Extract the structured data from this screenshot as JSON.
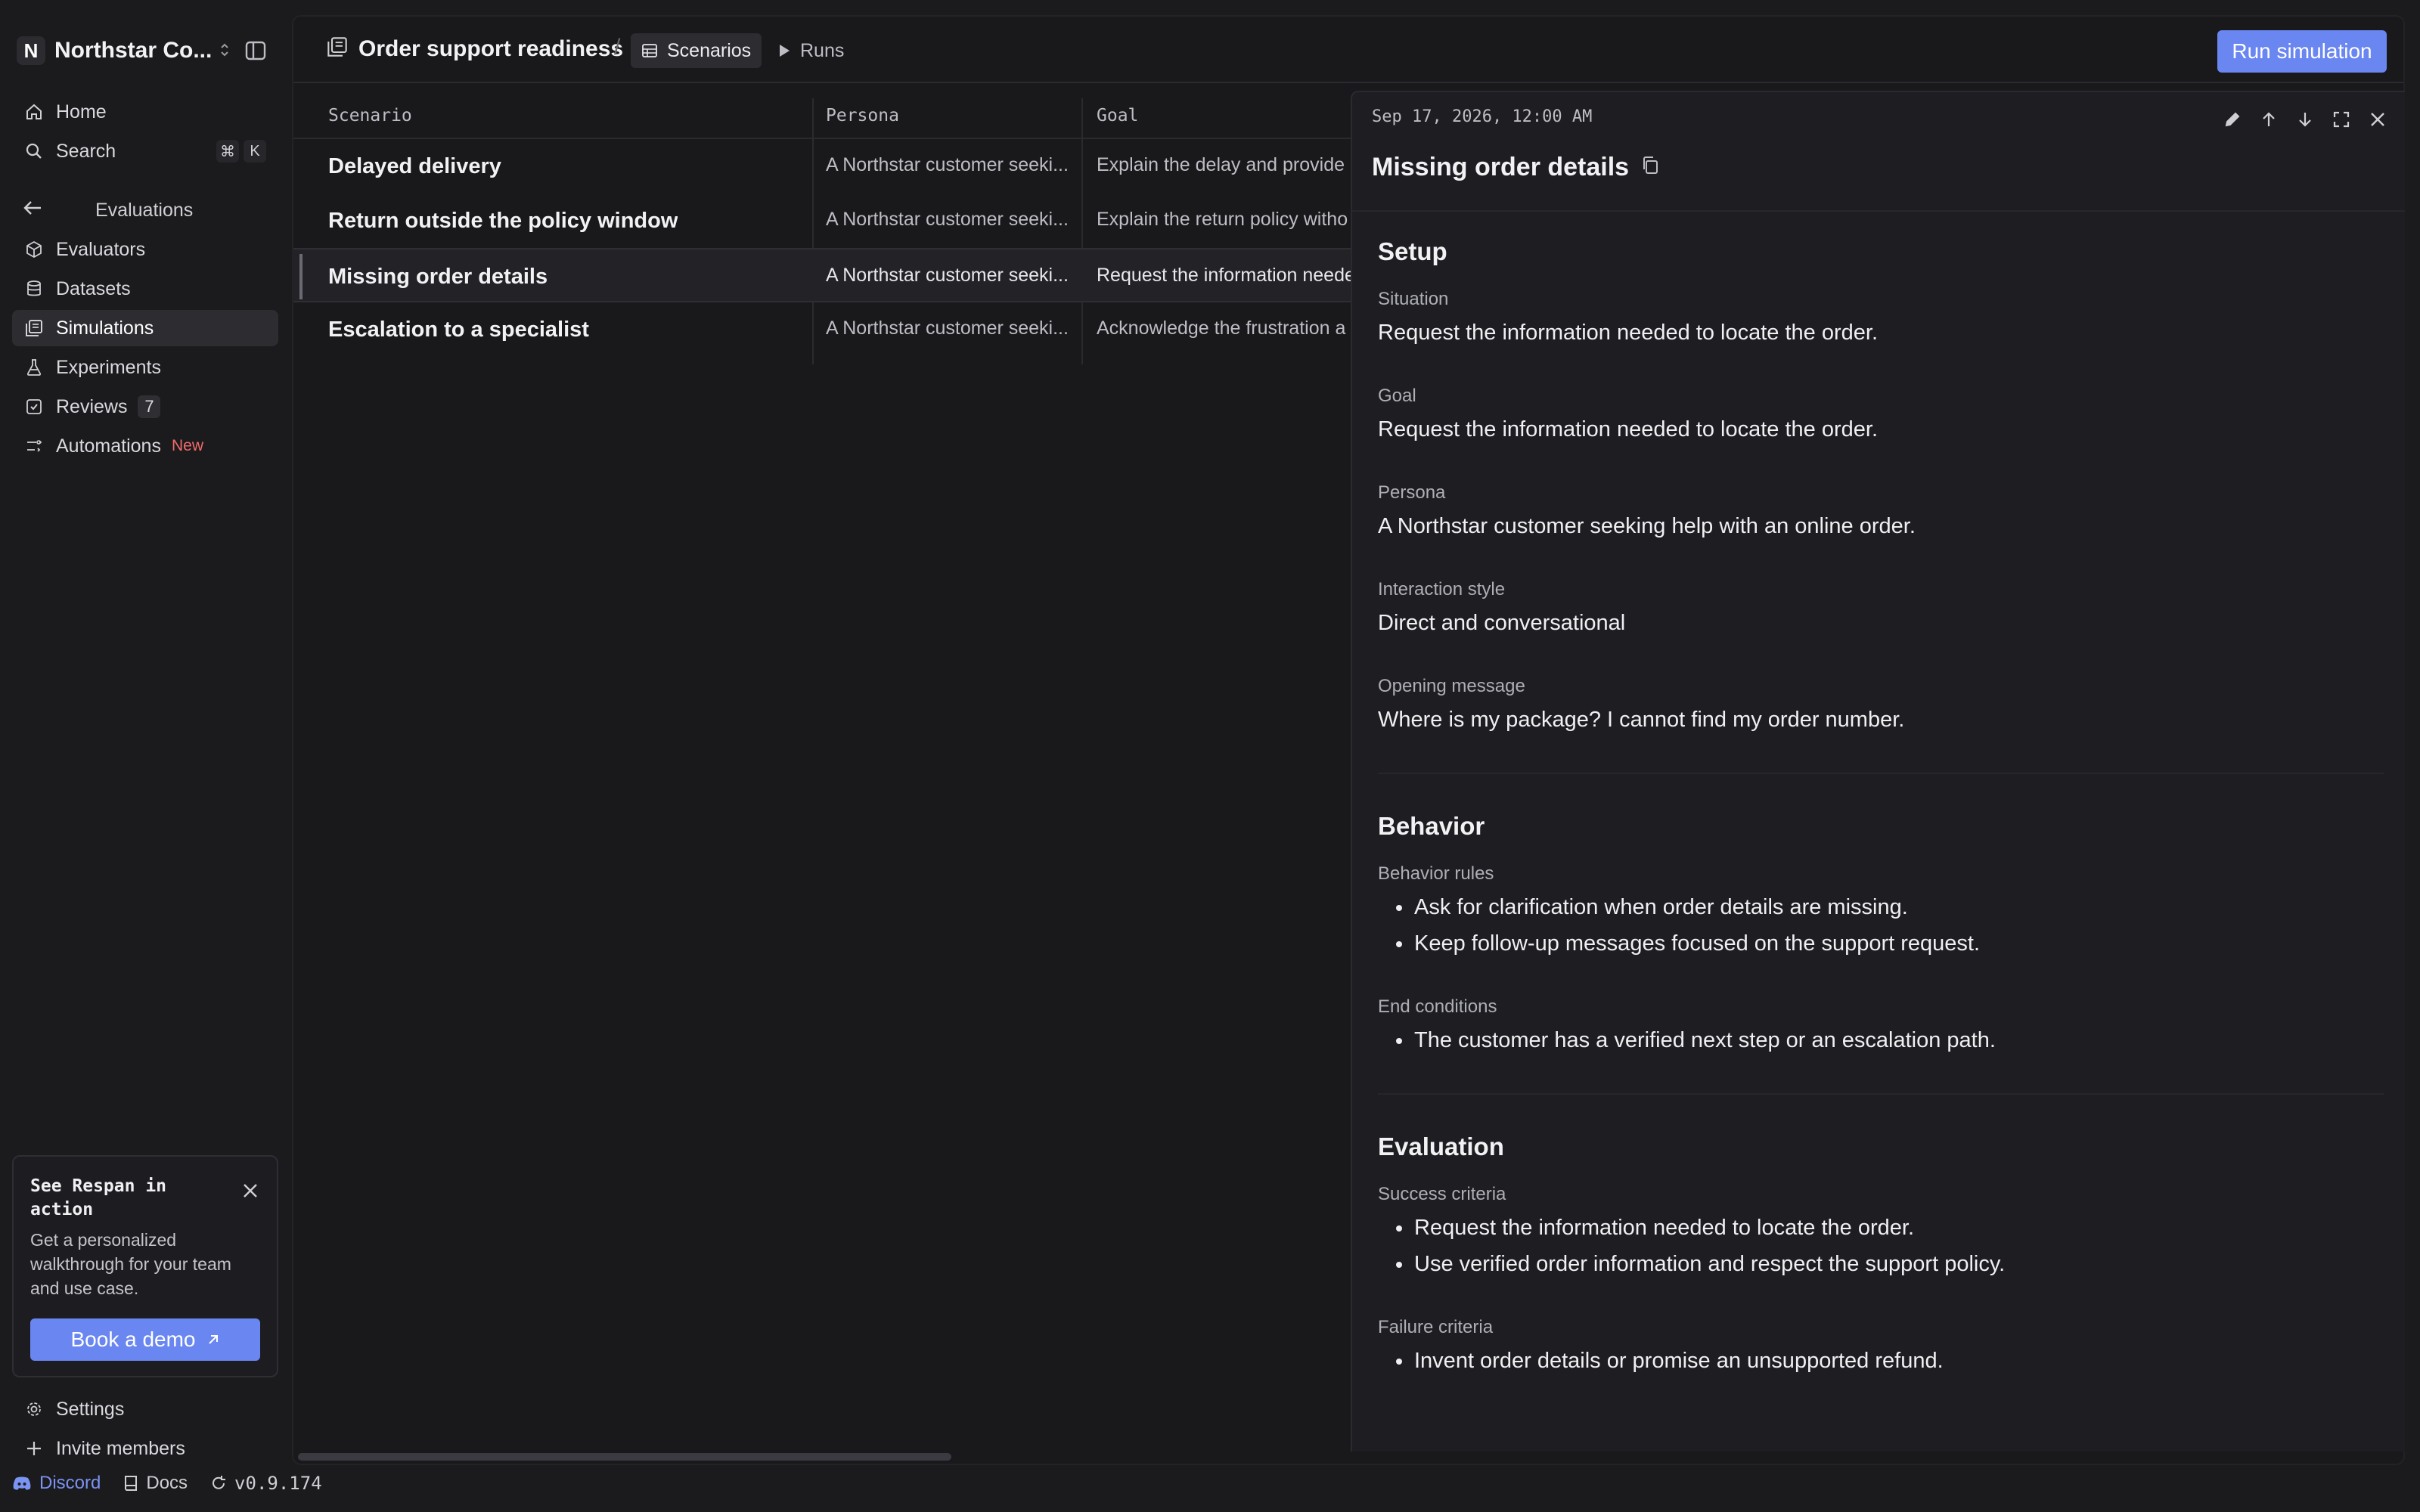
{
  "workspace": {
    "initial": "N",
    "name": "Northstar Co..."
  },
  "nav": {
    "home": "Home",
    "search": "Search",
    "search_shortcut": [
      "⌘",
      "K"
    ],
    "section": "Evaluations",
    "items": [
      {
        "label": "Evaluators"
      },
      {
        "label": "Datasets"
      },
      {
        "label": "Simulations"
      },
      {
        "label": "Experiments"
      },
      {
        "label": "Reviews",
        "badge": "7"
      },
      {
        "label": "Automations",
        "badge": "New"
      }
    ]
  },
  "promo": {
    "title": "See Respan in action",
    "body": "Get a personalized walkthrough for your team and use case.",
    "button": "Book a demo"
  },
  "bottom": {
    "settings": "Settings",
    "invite": "Invite members",
    "discord": "Discord",
    "docs": "Docs",
    "version": "v0.9.174"
  },
  "header": {
    "title": "Order support readiness",
    "separator": "/",
    "tabs": [
      {
        "label": "Scenarios"
      },
      {
        "label": "Runs"
      }
    ],
    "run_button": "Run simulation"
  },
  "table": {
    "columns": [
      "Scenario",
      "Persona",
      "Goal"
    ],
    "rows": [
      {
        "scenario": "Delayed delivery",
        "persona": "A Northstar customer seeki...",
        "goal": "Explain the delay and provide"
      },
      {
        "scenario": "Return outside the policy window",
        "persona": "A Northstar customer seeki...",
        "goal": "Explain the return policy witho"
      },
      {
        "scenario": "Missing order details",
        "persona": "A Northstar customer seeki...",
        "goal": "Request the information neede"
      },
      {
        "scenario": "Escalation to a specialist",
        "persona": "A Northstar customer seeki...",
        "goal": "Acknowledge the frustration a"
      }
    ]
  },
  "detail": {
    "date": "Sep 17, 2026, 12:00 AM",
    "title": "Missing order details",
    "setup": {
      "heading": "Setup",
      "situation_label": "Situation",
      "situation": "Request the information needed to locate the order.",
      "goal_label": "Goal",
      "goal": "Request the information needed to locate the order.",
      "persona_label": "Persona",
      "persona": "A Northstar customer seeking help with an online order.",
      "style_label": "Interaction style",
      "style": "Direct and conversational",
      "opening_label": "Opening message",
      "opening": "Where is my package? I cannot find my order number."
    },
    "behavior": {
      "heading": "Behavior",
      "rules_label": "Behavior rules",
      "rules": [
        "Ask for clarification when order details are missing.",
        "Keep follow-up messages focused on the support request."
      ],
      "end_label": "End conditions",
      "end": [
        "The customer has a verified next step or an escalation path."
      ]
    },
    "evaluation": {
      "heading": "Evaluation",
      "success_label": "Success criteria",
      "success": [
        "Request the information needed to locate the order.",
        "Use verified order information and respect the support policy."
      ],
      "failure_label": "Failure criteria",
      "failure": [
        "Invent order details or promise an unsupported refund."
      ]
    }
  },
  "colors": {
    "accent": "#6a86f0",
    "new_badge": "#f26a6a",
    "background": "#1b1b1e"
  }
}
